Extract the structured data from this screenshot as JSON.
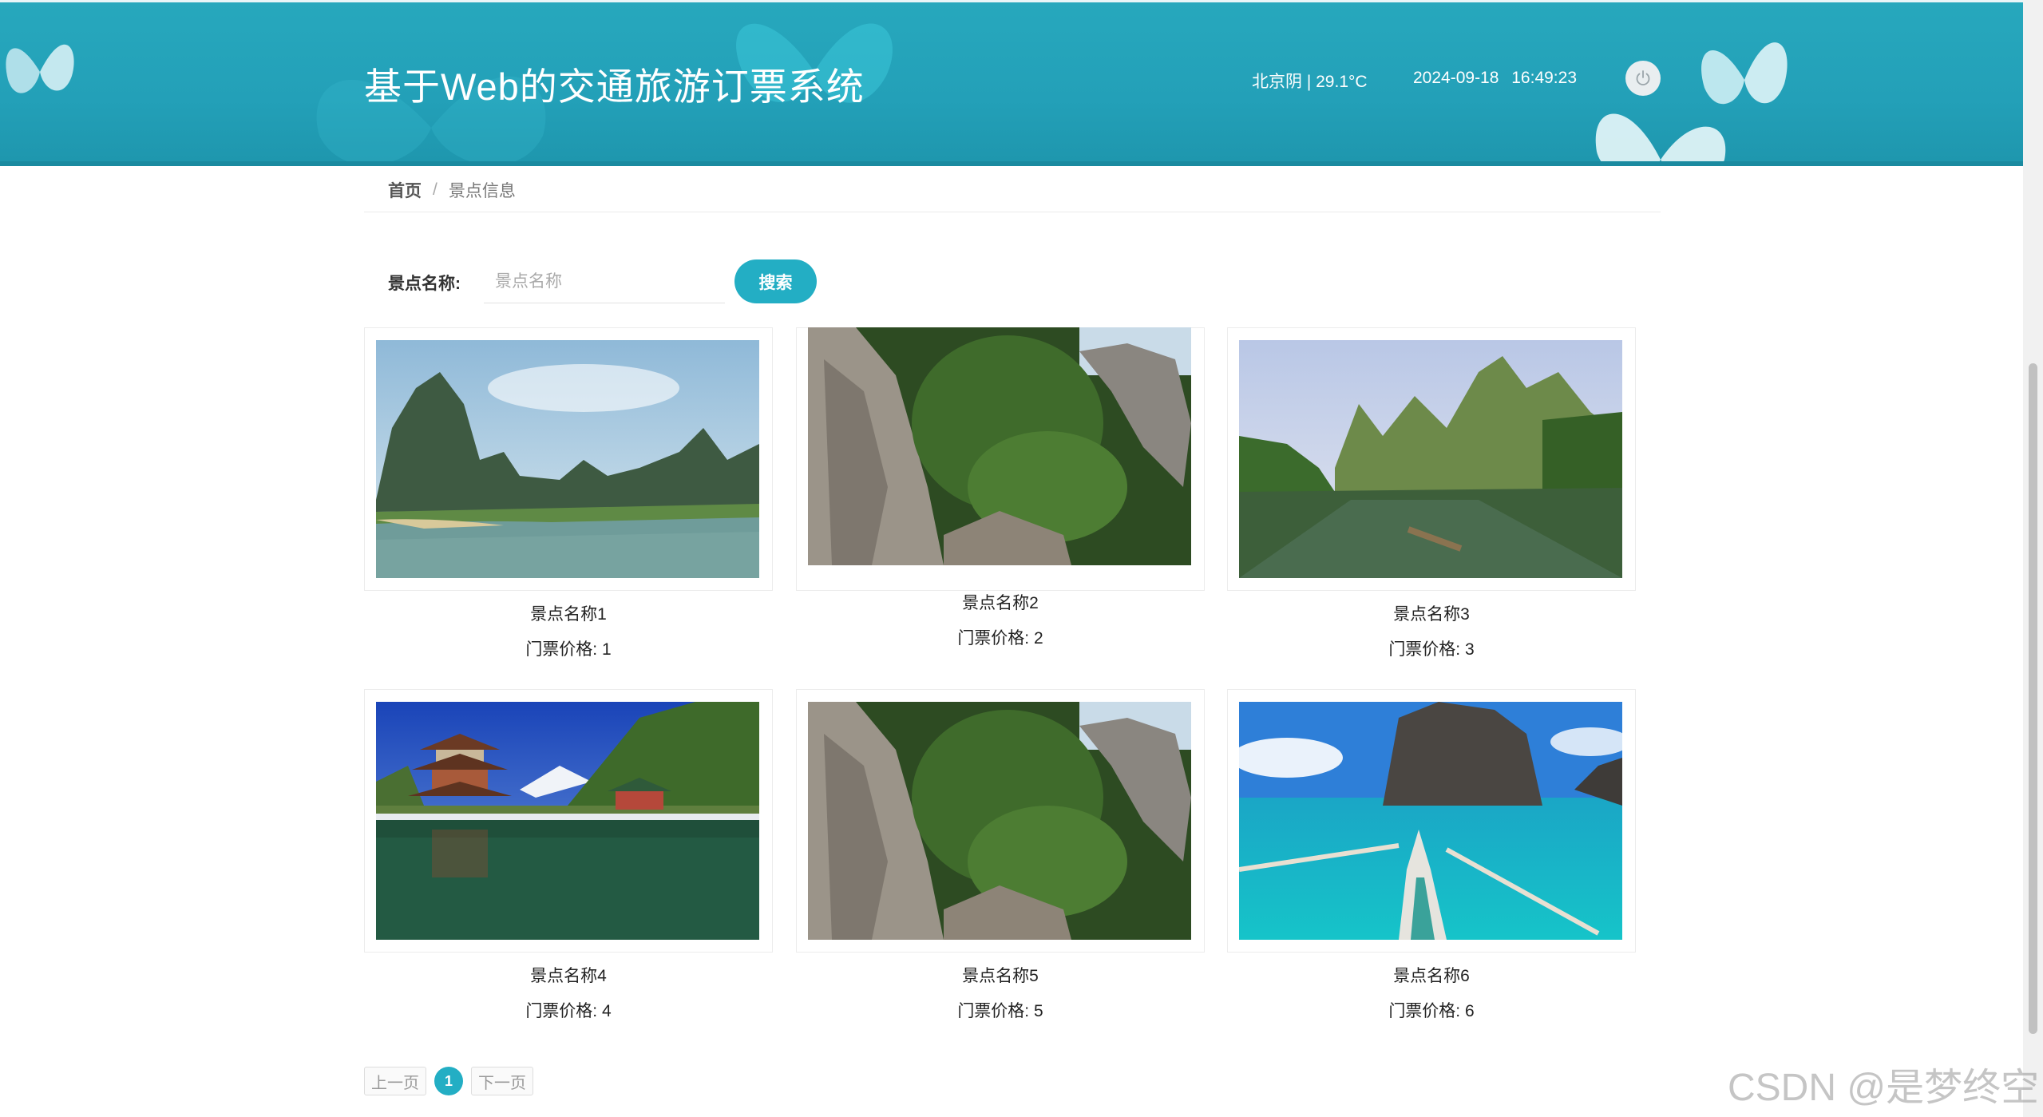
{
  "header": {
    "title": "基于Web的交通旅游订票系统",
    "weather": "北京阴 | 29.1°C",
    "datetime": "2024-09-18  16:49:23",
    "colors": {
      "primary": "#23a0b8",
      "accent": "#23aec4"
    },
    "logout_icon": "power-icon"
  },
  "breadcrumb": {
    "home": "首页",
    "separator": "/",
    "current": "景点信息"
  },
  "search": {
    "label": "景点名称:",
    "placeholder": "景点名称",
    "button": "搜索"
  },
  "cards": [
    {
      "name": "景点名称1",
      "price": "门票价格: 1",
      "image": "karst-river-landscape"
    },
    {
      "name": "景点名称2",
      "price": "门票价格: 2",
      "image": "stone-forest-cliffs"
    },
    {
      "name": "景点名称3",
      "price": "门票价格: 3",
      "image": "bamboo-raft-river"
    },
    {
      "name": "景点名称4",
      "price": "门票价格: 4",
      "image": "black-dragon-pool-pavilion"
    },
    {
      "name": "景点名称5",
      "price": "门票价格: 5",
      "image": "stone-forest-cliffs"
    },
    {
      "name": "景点名称6",
      "price": "门票价格: 6",
      "image": "turquoise-sea-boat"
    }
  ],
  "pagination": {
    "prev": "上一页",
    "current": "1",
    "next": "下一页"
  },
  "watermark": "CSDN @是梦终空"
}
